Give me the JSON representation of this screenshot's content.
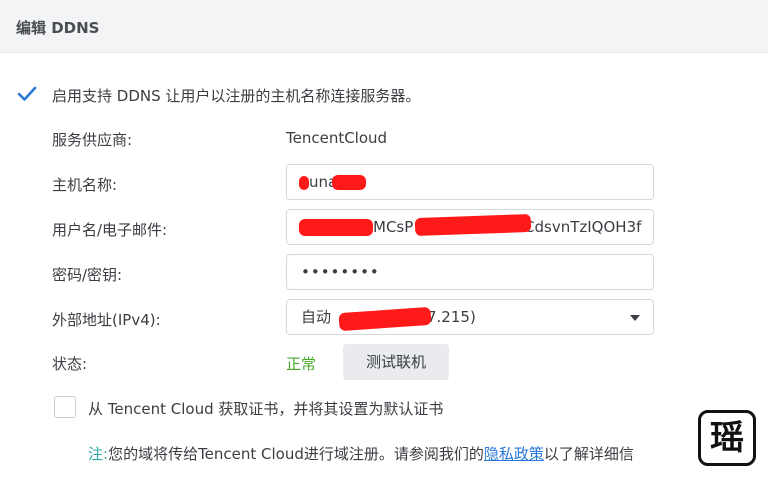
{
  "header": {
    "title": "编辑 DDNS"
  },
  "enable": {
    "label": "启用支持 DDNS 让用户以注册的主机名称连接服务器。",
    "checked": true
  },
  "form": {
    "provider": {
      "label": "服务供应商:",
      "value": "TencentCloud"
    },
    "hostname": {
      "label": "主机名称:",
      "value": "una"
    },
    "username": {
      "label": "用户名/电子邮件:",
      "value": "MCsP",
      "value_tail": "nbCdsvnTzIQOH3f"
    },
    "password": {
      "label": "密码/密钥:",
      "value": "••••••••"
    },
    "external_ip": {
      "label": "外部地址(IPv4):",
      "prefix": "自动",
      "suffix": "7.215)"
    },
    "status": {
      "label": "状态:",
      "value": "正常",
      "test_button": "测试联机"
    }
  },
  "cert": {
    "label": "从 Tencent Cloud 获取证书，并将其设置为默认证书",
    "checked": false
  },
  "note": {
    "tag": "注:",
    "text": "您的域将传给Tencent Cloud进行域注册。请参阅我们的",
    "link": "隐私政策",
    "after": "以了解详细信"
  },
  "logo": {
    "text": "瑶"
  },
  "colors": {
    "accent": "#2a79d8",
    "ok": "#47a82c",
    "note_tag": "#2aa5a1",
    "redaction": "#ff1a1a"
  }
}
